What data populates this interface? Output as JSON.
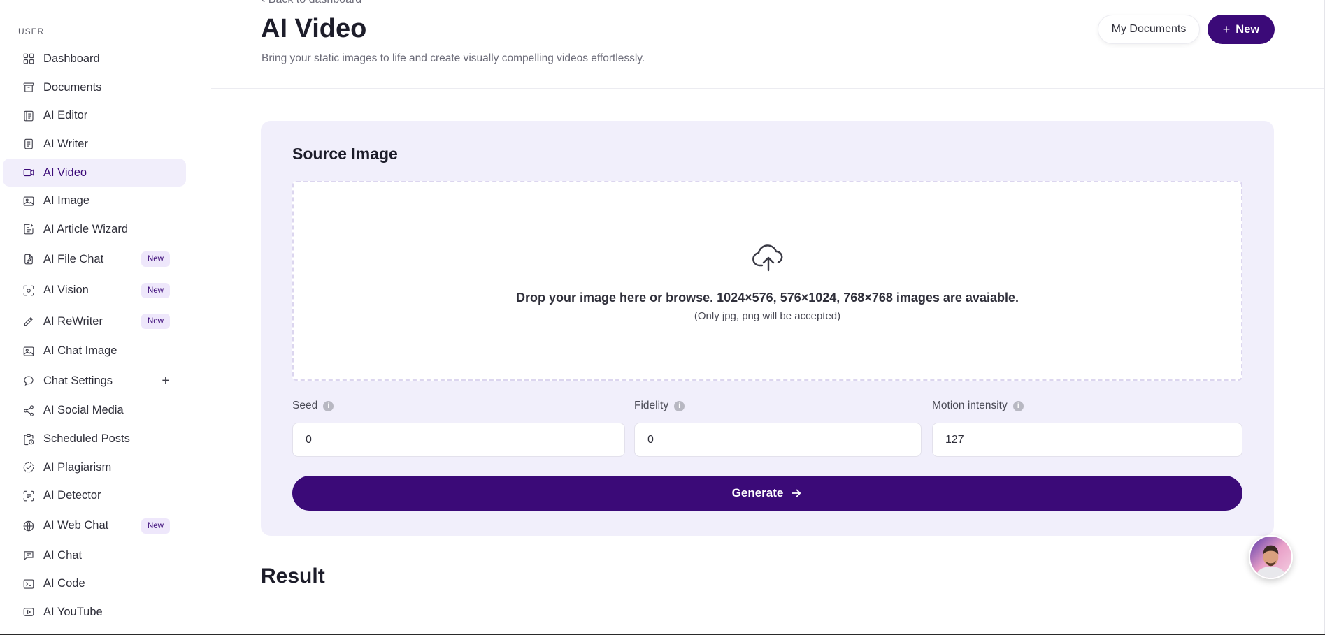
{
  "sidebar": {
    "section_label": "USER",
    "items": [
      {
        "label": "Dashboard",
        "icon": "grid-icon"
      },
      {
        "label": "Documents",
        "icon": "archive-icon"
      },
      {
        "label": "AI Editor",
        "icon": "editor-icon"
      },
      {
        "label": "AI Writer",
        "icon": "document-icon"
      },
      {
        "label": "AI Video",
        "icon": "video-icon",
        "active": true
      },
      {
        "label": "AI Image",
        "icon": "image-icon"
      },
      {
        "label": "AI Article Wizard",
        "icon": "wizard-icon"
      },
      {
        "label": "AI File Chat",
        "icon": "file-chat-icon",
        "badge": "New"
      },
      {
        "label": "AI Vision",
        "icon": "scan-face-icon",
        "badge": "New"
      },
      {
        "label": "AI ReWriter",
        "icon": "pencil-icon",
        "badge": "New"
      },
      {
        "label": "AI Chat Image",
        "icon": "image-icon"
      },
      {
        "label": "Chat Settings",
        "icon": "chat-bubble-icon",
        "plus": "+"
      },
      {
        "label": "AI Social Media",
        "icon": "share-icon"
      },
      {
        "label": "Scheduled Posts",
        "icon": "clipboard-clock-icon"
      },
      {
        "label": "AI Plagiarism",
        "icon": "check-circle-icon"
      },
      {
        "label": "AI Detector",
        "icon": "detector-icon"
      },
      {
        "label": "AI Web Chat",
        "icon": "www-icon",
        "badge": "New"
      },
      {
        "label": "AI Chat",
        "icon": "message-square-icon"
      },
      {
        "label": "AI Code",
        "icon": "terminal-icon"
      },
      {
        "label": "AI YouTube",
        "icon": "youtube-icon"
      }
    ]
  },
  "header": {
    "back_link": "Back to dashboard",
    "title": "AI Video",
    "subtitle": "Bring your static images to life and create visually compelling videos effortlessly.",
    "my_documents_label": "My Documents",
    "new_label": "New"
  },
  "card": {
    "title": "Source Image",
    "dropzone_text": "Drop your image here or browse. 1024×576, 576×1024, 768×768 images are avaiable.",
    "dropzone_subtext": "(Only jpg, png will be accepted)",
    "fields": {
      "seed": {
        "label": "Seed",
        "value": "0"
      },
      "fidelity": {
        "label": "Fidelity",
        "value": "0"
      },
      "motion": {
        "label": "Motion intensity",
        "value": "127"
      }
    },
    "generate_label": "Generate"
  },
  "result": {
    "title": "Result"
  },
  "colors": {
    "accent": "#3b0a78",
    "card_bg": "#f1effb",
    "active_bg": "#f1eefb"
  }
}
